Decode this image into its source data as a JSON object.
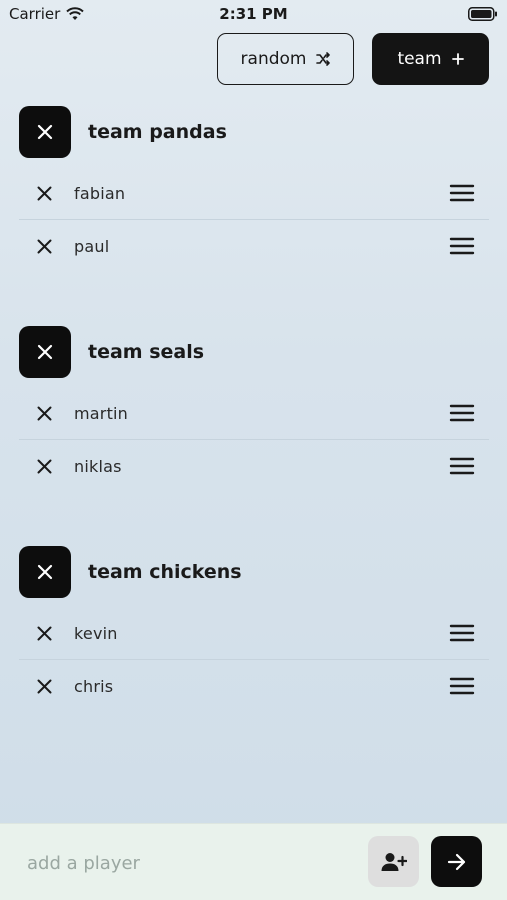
{
  "status_bar": {
    "carrier": "Carrier",
    "time": "2:31 PM"
  },
  "actions": {
    "random_label": "random",
    "team_label": "team"
  },
  "teams": [
    {
      "name": "team pandas",
      "players": [
        "fabian",
        "paul"
      ]
    },
    {
      "name": "team seals",
      "players": [
        "martin",
        "niklas"
      ]
    },
    {
      "name": "team chickens",
      "players": [
        "kevin",
        "chris"
      ]
    }
  ],
  "input": {
    "placeholder": "add a player",
    "value": ""
  },
  "icons": {
    "wifi": "wifi-icon",
    "battery": "battery-icon",
    "shuffle": "shuffle-icon",
    "plus": "plus-icon",
    "close": "close-icon",
    "drag": "drag-handle-icon",
    "add_person": "person-add-icon",
    "arrow": "arrow-right-icon"
  },
  "colors": {
    "primary": "#141414",
    "background": "#dae5ee",
    "bottom_bar": "#e9f2ec"
  }
}
